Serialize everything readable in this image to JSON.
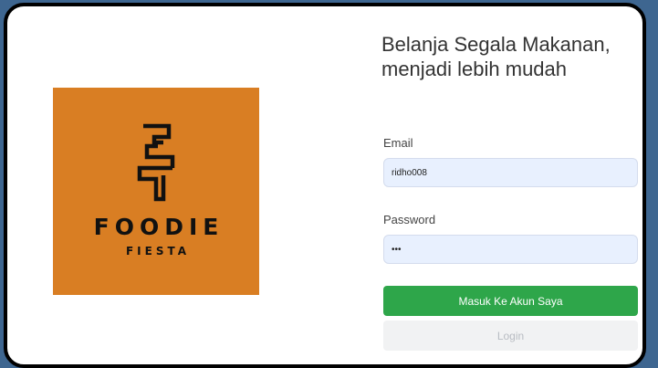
{
  "colors": {
    "background": "#3e6690",
    "logo_bg": "#d97e23",
    "primary_button": "#2ea64a",
    "input_bg": "#e8f0fe"
  },
  "logo": {
    "icon": "foodie-fiesta-f-icon",
    "name": "FOODIE",
    "subtitle": "FIESTA"
  },
  "headline": {
    "line1": "Belanja Segala Makanan,",
    "line2": "menjadi lebih mudah"
  },
  "form": {
    "email_label": "Email",
    "email_value": "ridho008",
    "password_label": "Password",
    "password_value": "•••",
    "submit_label": "Masuk Ke Akun Saya",
    "login_label": "Login"
  }
}
